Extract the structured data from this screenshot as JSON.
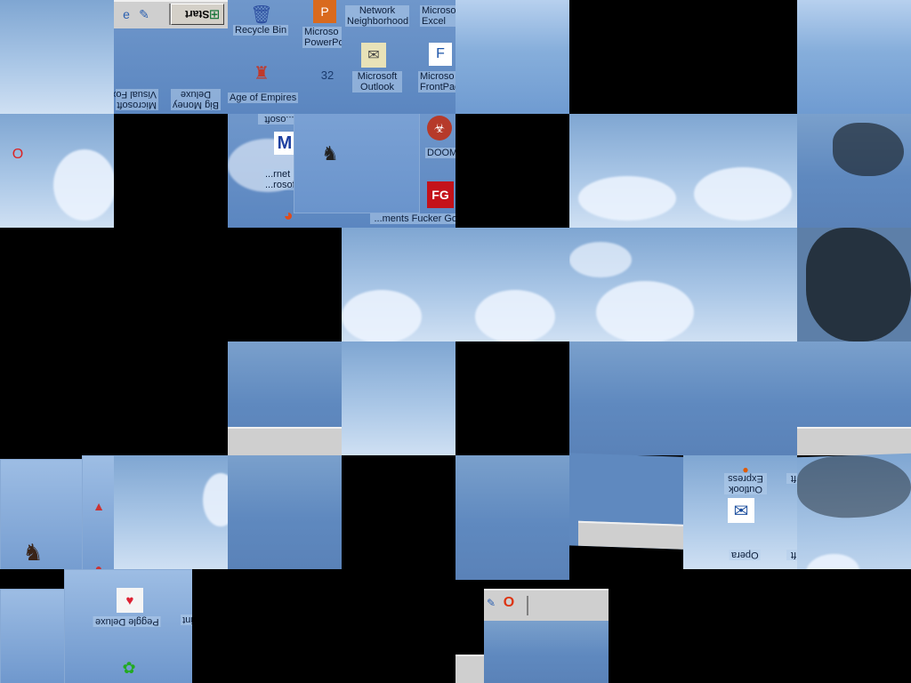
{
  "taskbar": {
    "start_label": "Start"
  },
  "desktop_icons": [
    {
      "label": "Recycle Bin",
      "icon": "recycle-bin-icon"
    },
    {
      "label": "Network Neighborhood",
      "icon": "network-icon"
    },
    {
      "label": "Microsoft Excel",
      "icon": "excel-icon"
    },
    {
      "label": "Microsoft PowerPoint",
      "icon": "powerpoint-icon"
    },
    {
      "label": "Age of Empires",
      "icon": "age-of-empires-icon"
    },
    {
      "label": "Microsoft Outlook",
      "icon": "outlook-icon"
    },
    {
      "label": "Microsoft FrontPage",
      "icon": "frontpage-icon"
    },
    {
      "label": "DOOM",
      "icon": "doom-icon"
    },
    {
      "label": "Fucker Go",
      "icon": "fg-icon"
    },
    {
      "label": "Microsoft Internet Explorer",
      "icon": "ie-icon"
    },
    {
      "label": "Microsoft Visual FoxPro",
      "icon": "foxpro-icon"
    },
    {
      "label": "Big Money Deluxe",
      "icon": "big-money-icon"
    },
    {
      "label": "Outlook Express",
      "icon": "outlook-express-icon"
    },
    {
      "label": "Opera",
      "icon": "opera-icon"
    },
    {
      "label": "Peggle Deluxe",
      "icon": "peggle-icon"
    }
  ],
  "fragments": {
    "recycle": "Recycle Bin",
    "network": "Network Neighborhood",
    "excel_a": "Microso",
    "excel_b": "Excel",
    "ppt_a": "Microso",
    "ppt_b": "PowerPo",
    "aoe": "Age of Empires",
    "outlook_a": "Microsoft",
    "outlook_b": "Outlook",
    "frontpage_a": "Microso",
    "frontpage_b": "FrontPag",
    "doom": "DOOM",
    "fg": "...ments  Fucker Go",
    "ie_a": "...rosoft",
    "ie_b": "...rnet Inte...",
    "ie_c": "...osoft",
    "foxpro_a": "Microsoft",
    "foxpro_b": "Visual Fox",
    "bigmoney_a": "Big Money",
    "bigmoney_b": "Deluxe",
    "oe_a": "Outlook",
    "oe_b": "Express",
    "opera": "Opera",
    "peggle": "Peggle Deluxe",
    "misc_a": "ft",
    "misc_b": "ft",
    "misc_c": "int"
  },
  "colors": {
    "accent": "#5b86c0",
    "taskbar": "#cfcfcf",
    "background": "#000000"
  }
}
